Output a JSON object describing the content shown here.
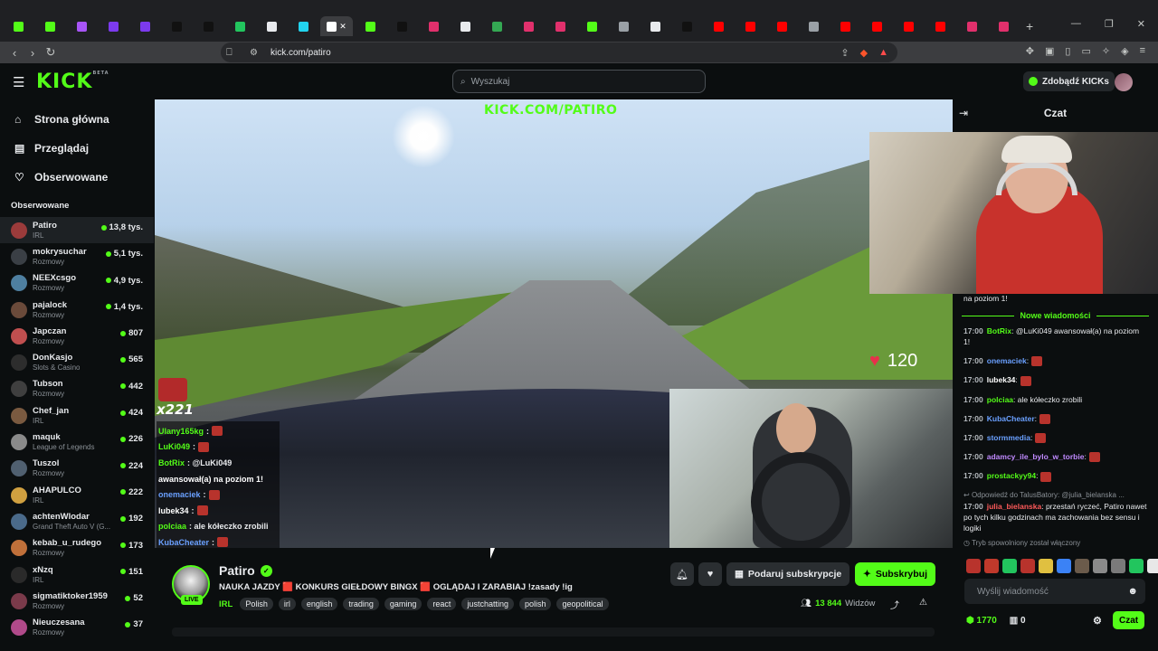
{
  "browser": {
    "url": "kick.com/patiro",
    "tab_count": 33
  },
  "header": {
    "logo": "KICK",
    "logo_sup": "BETA",
    "search_placeholder": "Wyszukaj",
    "get_kicks": "Zdobądź KICKs"
  },
  "sidebar": {
    "nav": [
      {
        "label": "Strona główna",
        "icon": "home-icon"
      },
      {
        "label": "Przeglądaj",
        "icon": "browse-icon"
      },
      {
        "label": "Obserwowane",
        "icon": "heart-icon"
      }
    ],
    "section_title": "Obserwowane",
    "channels": [
      {
        "name": "Patiro",
        "category": "IRL",
        "viewers": "13,8 tys.",
        "color": "#9b3b3b"
      },
      {
        "name": "mokrysuchar",
        "category": "Rozmowy",
        "viewers": "5,1 tys.",
        "color": "#3a3f45"
      },
      {
        "name": "NEEXcsgo",
        "category": "Rozmowy",
        "viewers": "4,9 tys.",
        "color": "#4e7fa0"
      },
      {
        "name": "pajalock",
        "category": "Rozmowy",
        "viewers": "1,4 tys.",
        "color": "#6a4a3a"
      },
      {
        "name": "Japczan",
        "category": "Rozmowy",
        "viewers": "807",
        "color": "#c04f4f"
      },
      {
        "name": "DonKasjo",
        "category": "Slots & Casino",
        "viewers": "565",
        "color": "#2d2d2d"
      },
      {
        "name": "Tubson",
        "category": "Rozmowy",
        "viewers": "442",
        "color": "#3f3f3f"
      },
      {
        "name": "Chef_jan",
        "category": "IRL",
        "viewers": "424",
        "color": "#7a5a40"
      },
      {
        "name": "maquk",
        "category": "League of Legends",
        "viewers": "226",
        "color": "#8a8a8a"
      },
      {
        "name": "Tuszol",
        "category": "Rozmowy",
        "viewers": "224",
        "color": "#506070"
      },
      {
        "name": "AHAPULCO",
        "category": "IRL",
        "viewers": "222",
        "color": "#d0a040"
      },
      {
        "name": "achtenWlodar",
        "category": "Grand Theft Auto V (G...",
        "viewers": "192",
        "color": "#4a6a8a"
      },
      {
        "name": "kebab_u_rudego",
        "category": "Rozmowy",
        "viewers": "173",
        "color": "#c0703a"
      },
      {
        "name": "xNzq",
        "category": "IRL",
        "viewers": "151",
        "color": "#2a2a2a"
      },
      {
        "name": "sigmatiktoker1959",
        "category": "Rozmowy",
        "viewers": "52",
        "color": "#7a3a4a"
      },
      {
        "name": "Nieuczesana",
        "category": "Rozmowy",
        "viewers": "37",
        "color": "#b04a8a"
      }
    ]
  },
  "video": {
    "overlay_url": "KICK.COM/PATIRO",
    "heart_rate": "120",
    "combo": "x221",
    "overlay_chat": [
      {
        "user": "Ulany165kg",
        "color": "#53fc18",
        "text": ":"
      },
      {
        "user": "LuKi049",
        "color": "#53fc18",
        "text": ":"
      },
      {
        "user": "BotRix",
        "color": "#53fc18",
        "text": ": @LuKi049"
      },
      {
        "user": "",
        "color": "#ffffff",
        "text": "awansował(a) na poziom 1!"
      },
      {
        "user": "onemaciek",
        "color": "#6aa0ff",
        "text": ":"
      },
      {
        "user": "lubek34",
        "color": "#ffffff",
        "text": ":"
      },
      {
        "user": "polciaa",
        "color": "#53fc18",
        "text": ": ale kółeczko zrobili"
      },
      {
        "user": "KubaCheater",
        "color": "#6aa0ff",
        "text": ":"
      }
    ]
  },
  "stream": {
    "name": "Patiro",
    "live": "LIVE",
    "title": "NAUKA JAZDY 🟥 KONKURS GIEŁDOWY BINGX 🟥 OGLĄDAJ I ZARABIAJ !zasady !ig",
    "category": "IRL",
    "tags": [
      "Polish",
      "irl",
      "english",
      "trading",
      "gaming",
      "react",
      "justchatting",
      "polish",
      "geopolitical"
    ],
    "gift_label": "Podaruj subskrypcje",
    "subscribe_label": "Subskrybuj",
    "viewers_num": "13 844",
    "viewers_label": "Widzów"
  },
  "chat": {
    "title": "Czat",
    "top_fragment": "na poziom 1!",
    "new_messages": "Nowe wiadomości",
    "messages": [
      {
        "time": "17:00",
        "user": "BotRix",
        "color": "#53fc18",
        "text": ": @LuKi049 awansował(a) na poziom 1!"
      },
      {
        "time": "17:00",
        "user": "onemaciek",
        "color": "#6aa0ff",
        "text": ":"
      },
      {
        "time": "17:00",
        "user": "lubek34",
        "color": "#ffffff",
        "text": ":"
      },
      {
        "time": "17:00",
        "user": "polciaa",
        "color": "#53fc18",
        "text": ": ale kółeczko zrobili"
      },
      {
        "time": "17:00",
        "user": "KubaCheater",
        "color": "#6aa0ff",
        "text": ":"
      },
      {
        "time": "17:00",
        "user": "stormmedia",
        "color": "#6aa0ff",
        "text": ":"
      },
      {
        "time": "17:00",
        "user": "adamcy_ile_bylo_w_torbie",
        "color": "#c08aff",
        "text": ":"
      },
      {
        "time": "17:00",
        "user": "prostackyy94",
        "color": "#53fc18",
        "text": ":"
      }
    ],
    "reply_to": "Odpowiedź do TalusBatory: @julia_bielanska ...",
    "reply_msg": {
      "time": "17:00",
      "user": "julia_bielanska",
      "color": "#ff5a5a",
      "text": ": przestań ryczeć, Patiro nawet po tych kilku godzinach ma zachowania bez sensu i logiki"
    },
    "slow_mode": "Tryb spowolniony został włączony",
    "input_placeholder": "Wyślij wiadomość",
    "kicks": "1770",
    "points": "0",
    "send_label": "Czat"
  }
}
